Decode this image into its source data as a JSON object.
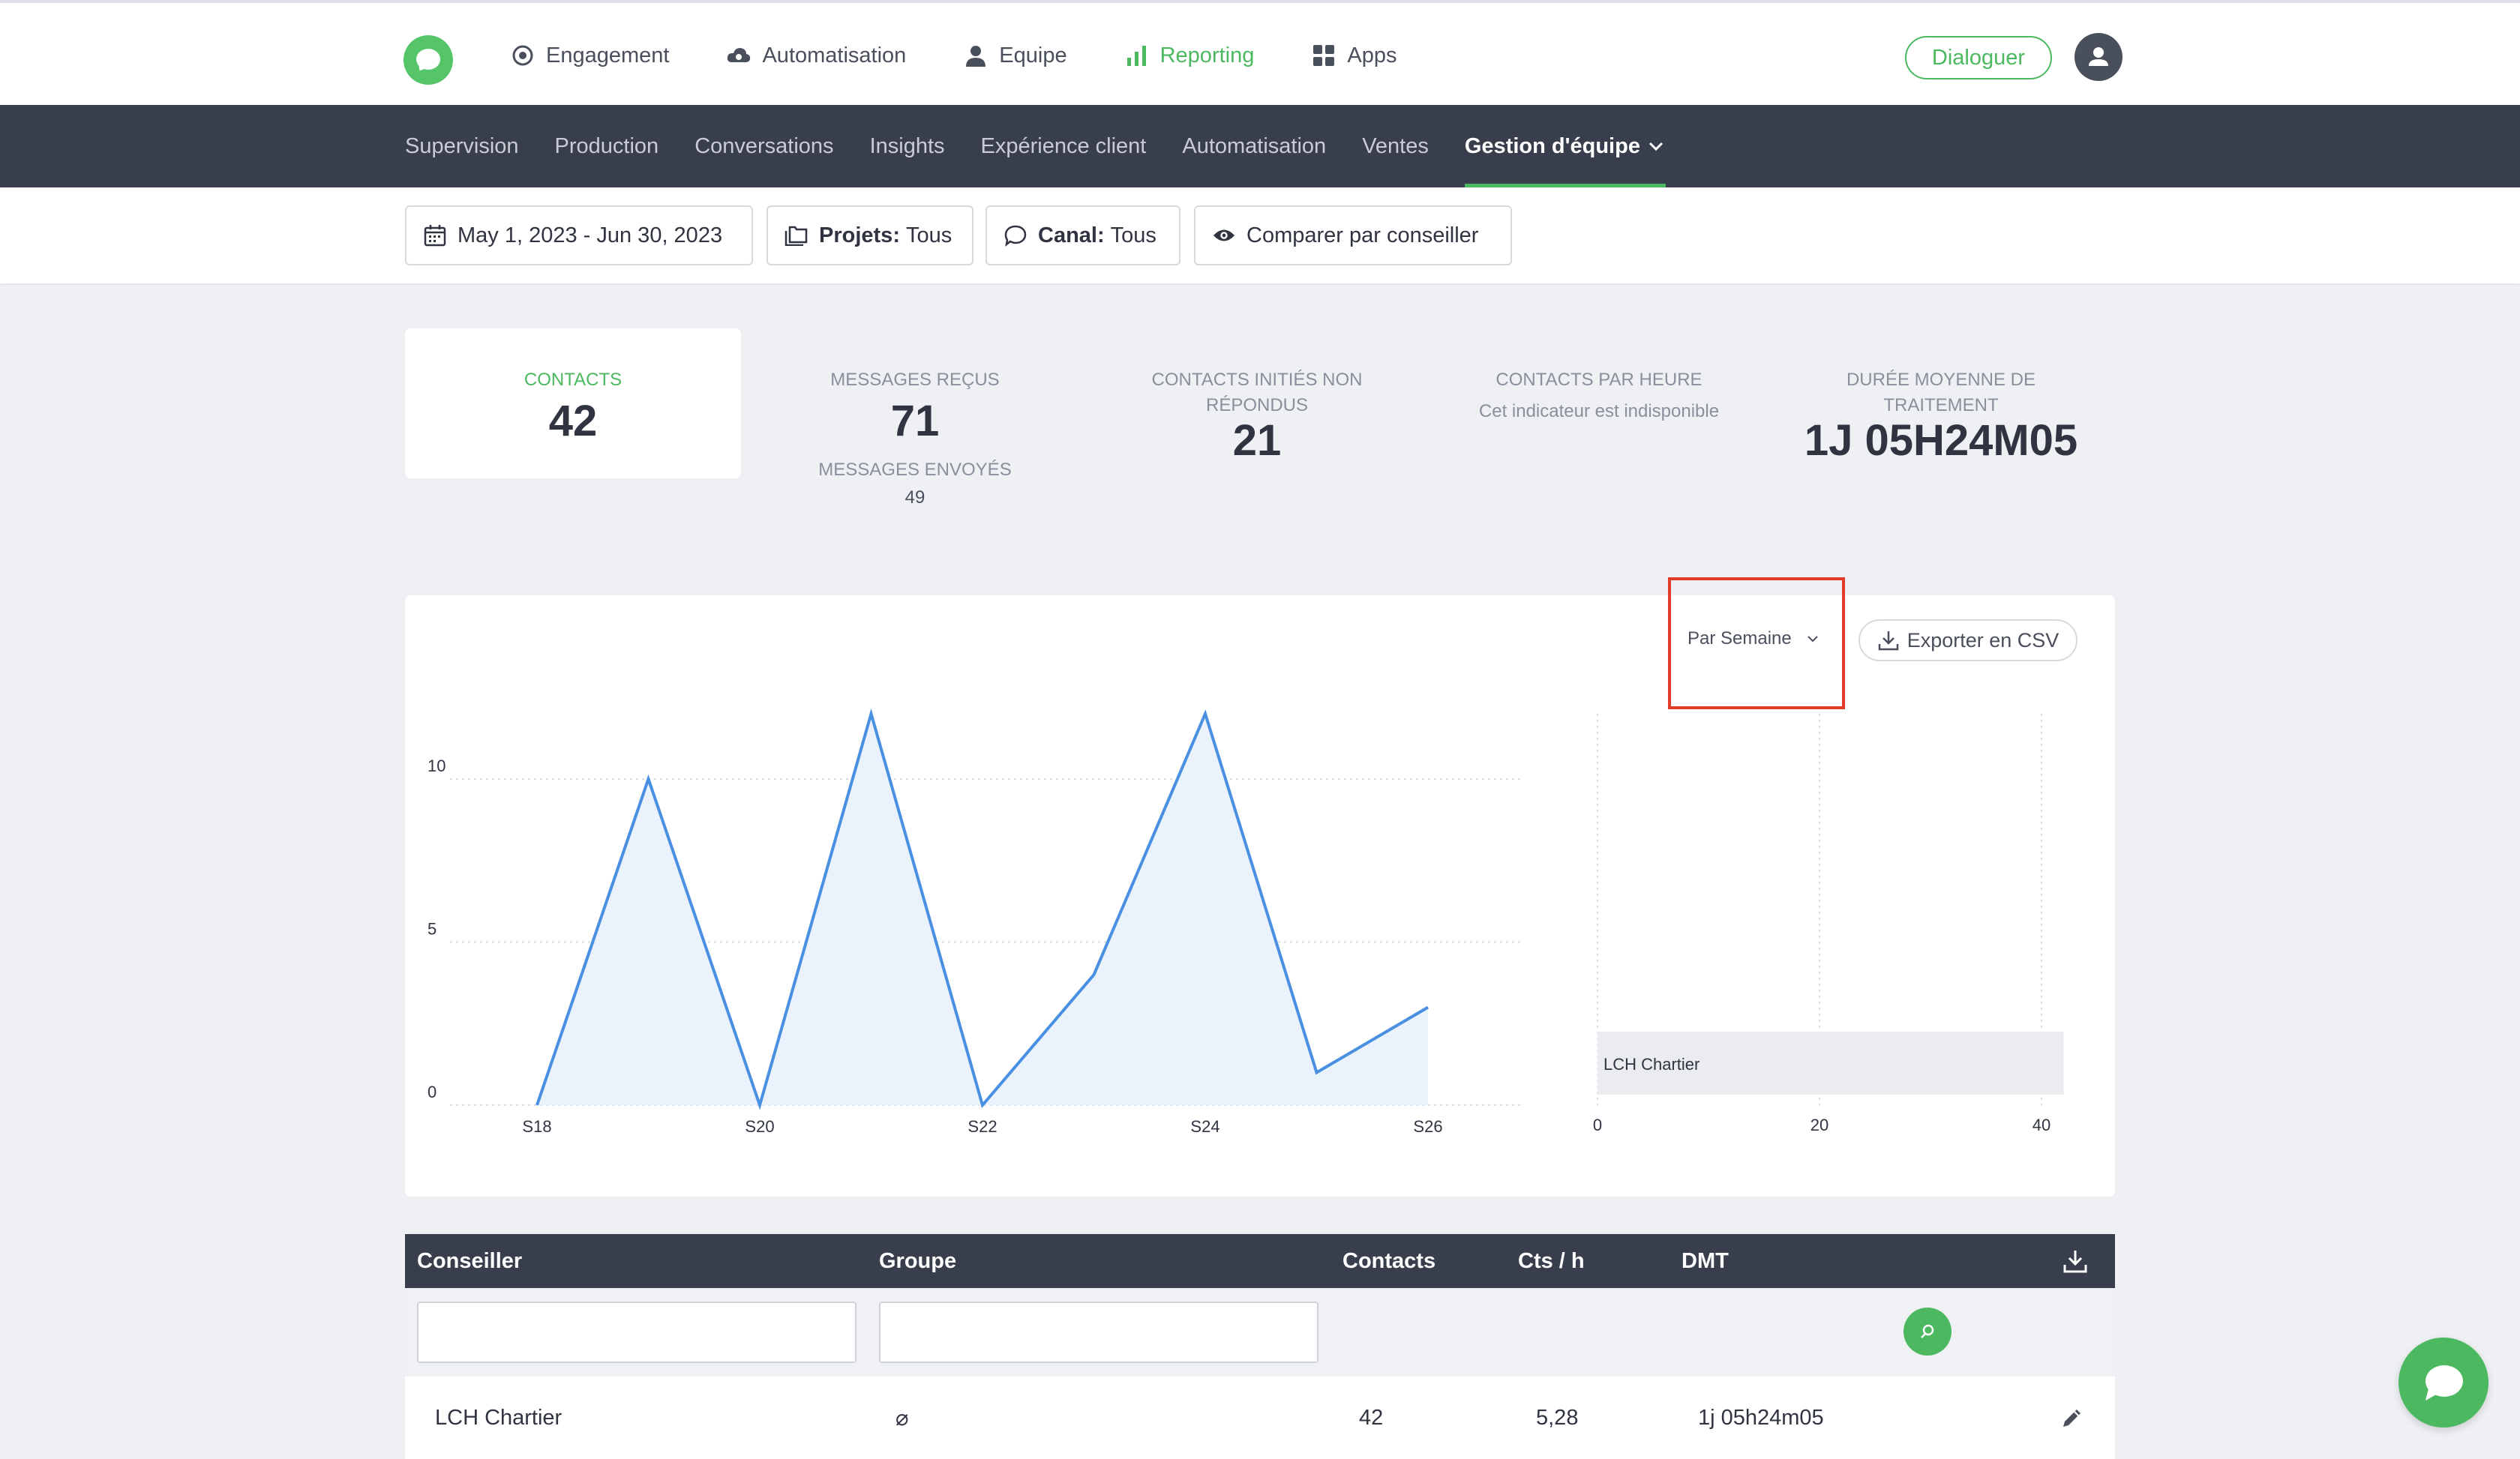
{
  "topnav": {
    "items": [
      {
        "label": "Engagement",
        "icon": "target-icon"
      },
      {
        "label": "Automatisation",
        "icon": "cloud-icon"
      },
      {
        "label": "Equipe",
        "icon": "user-icon"
      },
      {
        "label": "Reporting",
        "icon": "bar-chart-icon",
        "active": true
      },
      {
        "label": "Apps",
        "icon": "grid-icon"
      }
    ],
    "cta_label": "Dialoguer"
  },
  "subnav": {
    "tabs": [
      "Supervision",
      "Production",
      "Conversations",
      "Insights",
      "Expérience client",
      "Automatisation",
      "Ventes",
      "Gestion d'équipe"
    ]
  },
  "filters": {
    "date_range": "May 1, 2023 - Jun 30, 2023",
    "projets_label": "Projets:",
    "projets_value": "Tous",
    "canal_label": "Canal:",
    "canal_value": "Tous",
    "compare_label": "Comparer par conseiller"
  },
  "kpis": {
    "contacts": {
      "label": "CONTACTS",
      "value": "42"
    },
    "messages_recus": {
      "label": "MESSAGES REÇUS",
      "value": "71",
      "sub_label": "MESSAGES ENVOYÉS",
      "sub_value": "49"
    },
    "non_repondus": {
      "label_line1": "CONTACTS INITIÉS NON",
      "label_line2": "RÉPONDUS",
      "value": "21"
    },
    "par_heure": {
      "label": "CONTACTS PAR HEURE",
      "note": "Cet indicateur est indisponible"
    },
    "dmt": {
      "label_line1": "DURÉE MOYENNE DE",
      "label_line2": "TRAITEMENT",
      "value": "1J 05H24M05"
    }
  },
  "chart_controls": {
    "granularity": "Par Semaine",
    "export_label": "Exporter en CSV"
  },
  "chart_data": [
    {
      "type": "area",
      "x": [
        "S18",
        "S19",
        "S20",
        "S21",
        "S22",
        "S23",
        "S24",
        "S25",
        "S26"
      ],
      "x_tick_labels": [
        "S18",
        "S20",
        "S22",
        "S24",
        "S26"
      ],
      "values": [
        0,
        10,
        0,
        12,
        0,
        4,
        12,
        1,
        3
      ],
      "ylim": [
        0,
        12
      ],
      "y_ticks": [
        0,
        5,
        10
      ],
      "grid": true,
      "color": "#4a90e2"
    },
    {
      "type": "bar",
      "orientation": "horizontal",
      "categories": [
        "LCH Chartier"
      ],
      "values": [
        42
      ],
      "xlim": [
        0,
        42
      ],
      "x_ticks": [
        0,
        20,
        40
      ],
      "color": "#ebecef"
    }
  ],
  "table": {
    "headers": {
      "conseiller": "Conseiller",
      "groupe": "Groupe",
      "contacts": "Contacts",
      "cts_h": "Cts / h",
      "dmt": "DMT"
    },
    "rows": [
      {
        "conseiller": "LCH Chartier",
        "groupe": "⌀",
        "contacts": "42",
        "cts_h": "5,28",
        "dmt": "1j 05h24m05"
      }
    ]
  }
}
